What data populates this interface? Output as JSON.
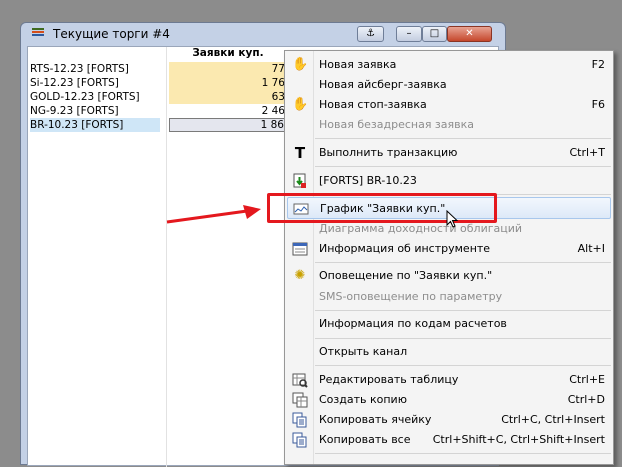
{
  "window": {
    "title": "Текущие торги #4",
    "buttons": {
      "anchor": "⚓",
      "minimize": "–",
      "maximize": "□",
      "close": "✕"
    }
  },
  "table": {
    "header": "Заявки куп.",
    "rows": [
      {
        "name": "RTS-12.23 [FORTS]",
        "value": "77",
        "highlight": "yellow"
      },
      {
        "name": "Si-12.23 [FORTS]",
        "value": "1 76",
        "highlight": "yellow"
      },
      {
        "name": "GOLD-12.23 [FORTS]",
        "value": "63",
        "highlight": "yellow"
      },
      {
        "name": "NG-9.23 [FORTS]",
        "value": "2 46",
        "highlight": "none"
      },
      {
        "name": "BR-10.23 [FORTS]",
        "value": "1 86",
        "highlight": "selected"
      }
    ]
  },
  "menu": {
    "items": [
      {
        "id": "new-order",
        "label": "Новая заявка",
        "shortcut": "F2",
        "icon": "hand-icon",
        "disabled": false
      },
      {
        "id": "new-iceberg",
        "label": "Новая айсберг-заявка",
        "shortcut": "",
        "icon": "",
        "disabled": false
      },
      {
        "id": "new-stop",
        "label": "Новая стоп-заявка",
        "shortcut": "F6",
        "icon": "stop-hand-icon",
        "disabled": false
      },
      {
        "id": "new-addressless",
        "label": "Новая безадресная заявка",
        "shortcut": "",
        "icon": "",
        "disabled": true
      },
      {
        "id": "execute-transaction",
        "label": "Выполнить транзакцию",
        "shortcut": "Ctrl+T",
        "icon": "t-icon",
        "disabled": false
      },
      {
        "id": "instrument-br",
        "label": "[FORTS] BR-10.23",
        "shortcut": "",
        "icon": "download-icon",
        "disabled": false
      },
      {
        "id": "chart-bids",
        "label": "График \"Заявки куп.\"",
        "shortcut": "",
        "icon": "chart-icon",
        "disabled": false
      },
      {
        "id": "bond-yield",
        "label": "Диаграмма доходности облигаций",
        "shortcut": "",
        "icon": "",
        "disabled": true
      },
      {
        "id": "instrument-info",
        "label": "Информация об инструменте",
        "shortcut": "Alt+I",
        "icon": "info-table-icon",
        "disabled": false
      },
      {
        "id": "alert-bids",
        "label": "Оповещение по \"Заявки куп.\"",
        "shortcut": "",
        "icon": "alert-icon",
        "disabled": false
      },
      {
        "id": "sms-alert",
        "label": "SMS-оповещение по параметру",
        "shortcut": "",
        "icon": "",
        "disabled": true
      },
      {
        "id": "settlement-info",
        "label": "Информация по кодам расчетов",
        "shortcut": "",
        "icon": "",
        "disabled": false
      },
      {
        "id": "open-channel",
        "label": "Открыть канал",
        "shortcut": "",
        "icon": "",
        "disabled": false
      },
      {
        "id": "edit-table",
        "label": "Редактировать таблицу",
        "shortcut": "Ctrl+E",
        "icon": "edit-table-icon",
        "disabled": false
      },
      {
        "id": "create-copy",
        "label": "Создать копию",
        "shortcut": "Ctrl+D",
        "icon": "copy-table-icon",
        "disabled": false
      },
      {
        "id": "copy-cell",
        "label": "Копировать ячейку",
        "shortcut": "Ctrl+C, Ctrl+Insert",
        "icon": "copy-icon",
        "disabled": false
      },
      {
        "id": "copy-all",
        "label": "Копировать все",
        "shortcut": "Ctrl+Shift+C, Ctrl+Shift+Insert",
        "icon": "copy-all-icon",
        "disabled": false
      }
    ]
  },
  "colors": {
    "highlight_box": "#e4181e",
    "arrow": "#e4181e",
    "yellow_cell": "#fbe9b0"
  }
}
